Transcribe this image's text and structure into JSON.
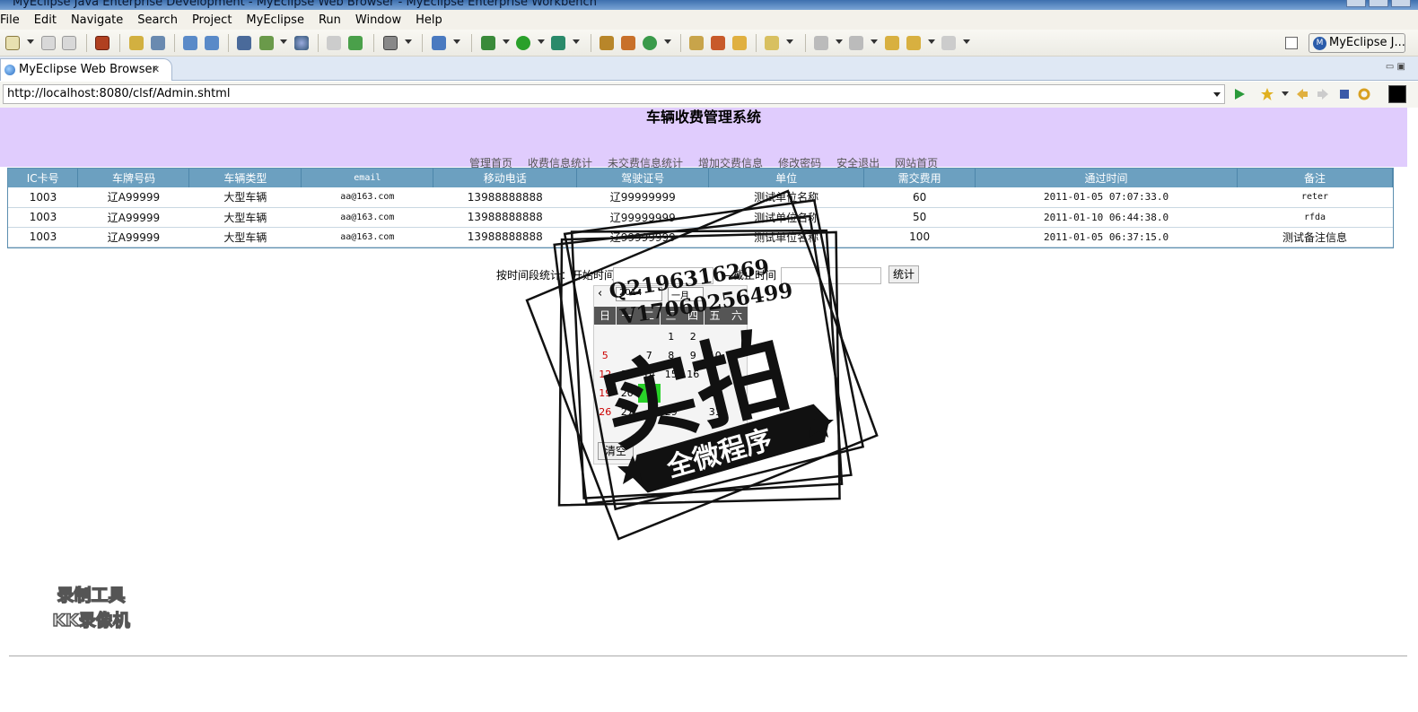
{
  "window": {
    "title": "MyEclipse Java Enterprise Development - MyEclipse Web Browser - MyEclipse Enterprise Workbench"
  },
  "menu": [
    "File",
    "Edit",
    "Navigate",
    "Search",
    "Project",
    "MyEclipse",
    "Run",
    "Window",
    "Help"
  ],
  "perspective": {
    "label": "MyEclipse J..."
  },
  "tab": {
    "label": "MyEclipse Web Browser"
  },
  "browser": {
    "url": "http://localhost:8080/clsf/Admin.shtml"
  },
  "site": {
    "title": "车辆收费管理系统",
    "nav": [
      "管理首页",
      "收费信息统计",
      "未交费信息统计",
      "增加交费信息",
      "修改密码",
      "安全退出",
      "网站首页"
    ]
  },
  "table": {
    "headers": [
      "IC卡号",
      "车牌号码",
      "车辆类型",
      "email",
      "移动电话",
      "驾驶证号",
      "单位",
      "需交费用",
      "通过时间",
      "备注"
    ],
    "rows": [
      [
        "1003",
        "辽A99999",
        "大型车辆",
        "aa@163.com",
        "13988888888",
        "辽99999999",
        "测试单位名称",
        "60",
        "2011-01-05 07:07:33.0",
        "reter"
      ],
      [
        "1003",
        "辽A99999",
        "大型车辆",
        "aa@163.com",
        "13988888888",
        "辽99999999",
        "测试单位名称",
        "50",
        "2011-01-10 06:44:38.0",
        "rfda"
      ],
      [
        "1003",
        "辽A99999",
        "大型车辆",
        "aa@163.com",
        "13988888888",
        "辽99999999",
        "测试单位名称",
        "100",
        "2011-01-05 06:37:15.0",
        "测试备注信息"
      ]
    ]
  },
  "filter": {
    "label": "按时间段统计：开始时间",
    "end_label": "—截止时间",
    "button": "统计"
  },
  "calendar": {
    "prev": "‹",
    "year": "2014",
    "month": "一月",
    "weekdays": [
      "日",
      "一",
      "二",
      "三",
      "四",
      "五",
      "六"
    ],
    "weeks": [
      [
        "",
        "",
        "",
        "1",
        "2",
        "",
        ""
      ],
      [
        "5",
        "",
        "7",
        "8",
        "9",
        "10",
        ""
      ],
      [
        "12",
        "13",
        "14",
        "15",
        "16",
        "",
        ""
      ],
      [
        "19",
        "20",
        "",
        "",
        "",
        "24",
        ""
      ],
      [
        "26",
        "27",
        "",
        "29",
        "",
        "31",
        ""
      ]
    ],
    "clear": "清空"
  },
  "watermark": {
    "qq": "Q2196316269",
    "v": "V17060256499",
    "main": "实拍",
    "banner": "全微程序",
    "recorder_line1": "录制工具",
    "recorder_line2": "KK录像机"
  }
}
